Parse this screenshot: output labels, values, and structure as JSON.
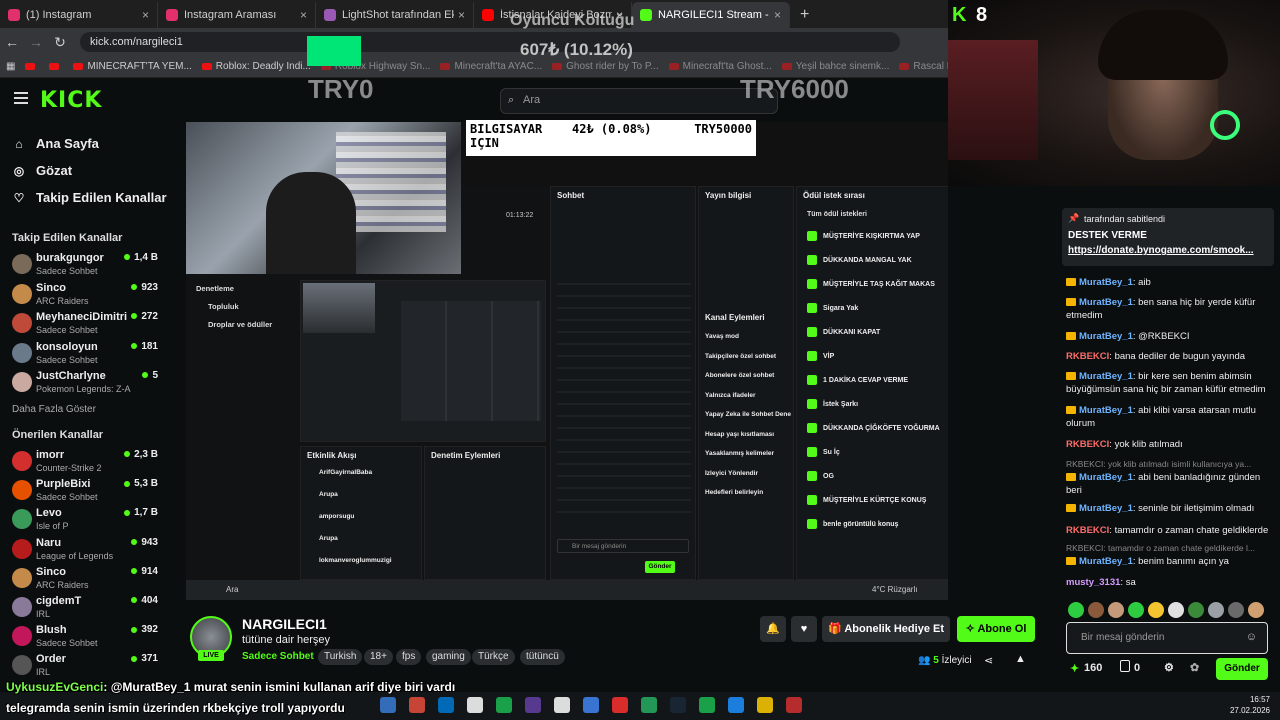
{
  "browser": {
    "tabs": [
      {
        "label": "(1) Instagram",
        "color": "#e1306c"
      },
      {
        "label": "Instagram Araması",
        "color": "#e1306c"
      },
      {
        "label": "LightShot tarafından Ekran Görü",
        "color": "#9b59b6"
      },
      {
        "label": "İstisnalar Kaideyi Bozmaz - You",
        "color": "#ff0000"
      },
      {
        "label": "NARGILECI1 Stream - Watc",
        "color": "#53fc18"
      }
    ],
    "new_tab": "+",
    "url": "kick.com/nargileci1",
    "bookmarks": [
      "",
      "",
      "MINECRAFT'TA YEM...",
      "Roblox: Deadly Indi...",
      "Roblox Highway Sn...",
      "Minecraft'ta AYAC...",
      "Ghost rider by To P...",
      "Minecraft'ta Ghost...",
      "Yeşil bahce sinemk...",
      "Rascal Does Not Dr..."
    ]
  },
  "header": {
    "logo": "KICK",
    "search_placeholder": "Ara"
  },
  "donation": {
    "title": "Oyuncu Koltuğu",
    "amount": "607₺ (10.12%)",
    "min": "TRY0",
    "max": "TRY6000",
    "pc_label": "BILGISAYAR",
    "pc_label2": "IÇIN",
    "pc_amount": "42₺ (0.08%)",
    "pc_goal": "TRY50000"
  },
  "sidebar": {
    "nav": [
      {
        "label": "Ana Sayfa",
        "icon": "home-icon"
      },
      {
        "label": "Gözat",
        "icon": "compass-icon"
      },
      {
        "label": "Takip Edilen Kanallar",
        "icon": "heart-icon"
      }
    ],
    "following_title": "Takip Edilen Kanallar",
    "following": [
      {
        "name": "burakgungor",
        "category": "Sadece Sohbet",
        "viewers": "1,4 B",
        "color": "#7a6a5a"
      },
      {
        "name": "Sinco",
        "category": "ARC Raiders",
        "viewers": "923",
        "color": "#c48a4a"
      },
      {
        "name": "MeyhaneciDimitri",
        "category": "Sadece Sohbet",
        "viewers": "272",
        "color": "#c04a3a"
      },
      {
        "name": "konsoloyun",
        "category": "Sadece Sohbet",
        "viewers": "181",
        "color": "#6a7a8a"
      },
      {
        "name": "JustCharlyne",
        "category": "Pokemon Legends: Z-A",
        "viewers": "5",
        "color": "#c9a9a0"
      }
    ],
    "more": "Daha Fazla Göster",
    "recommended_title": "Önerilen Kanallar",
    "recommended": [
      {
        "name": "imorr",
        "category": "Counter-Strike 2",
        "viewers": "2,3 B",
        "color": "#d32f2f"
      },
      {
        "name": "PurpleBixi",
        "category": "Sadece Sohbet",
        "viewers": "5,3 B",
        "color": "#e65100"
      },
      {
        "name": "Levo",
        "category": "Isle of P",
        "viewers": "1,7 B",
        "color": "#3a9a5a"
      },
      {
        "name": "Naru",
        "category": "League of Legends",
        "viewers": "943",
        "color": "#b71c1c"
      },
      {
        "name": "Sinco",
        "category": "ARC Raiders",
        "viewers": "914",
        "color": "#c48a4a"
      },
      {
        "name": "cigdemT",
        "category": "IRL",
        "viewers": "404",
        "color": "#8a7a9a"
      },
      {
        "name": "Blush",
        "category": "Sadece Sohbet",
        "viewers": "392",
        "color": "#c2185b"
      },
      {
        "name": "Order",
        "category": "IRL",
        "viewers": "371",
        "color": "#555"
      }
    ]
  },
  "inner_stream": {
    "panels": [
      "Sohbet",
      "Yayın bilgisi",
      "Ödül istek sırası",
      "Kanal Eylemleri",
      "Etkinlik Akışı",
      "Denetim Eylemleri"
    ],
    "side_menu": [
      "Denetleme",
      "Topluluk",
      "Droplar ve ödüller"
    ],
    "rewards_title": "Tüm ödül istekleri",
    "rewards": [
      "MÜŞTERİYE KIŞKIRTMA YAP",
      "DÜKKANDA MANGAL YAK",
      "MÜŞTERİYLE TAŞ KAĞIT MAKAS",
      "Sigara Yak",
      "DÜKKANI KAPAT",
      "VİP",
      "1 DAKİKA CEVAP VERME",
      "İstek Şarkı",
      "DÜKKANDA ÇİĞKÖFTE YOĞURMA",
      "Su İç",
      "OG",
      "MÜŞTERİYLE KÜRTÇE KONUŞ",
      "benle görüntülü konuş"
    ],
    "actions": [
      "Yavaş mod",
      "Takipçilere özel sohbet",
      "Abonelere özel sohbet",
      "Yalnızca ifadeler",
      "Yapay Zeka ile Sohbet Denetimi",
      "Hesap yaşı kısıtlaması",
      "Yasaklanmış kelimeler",
      "İzleyici Yönlendir",
      "Hedefleri belirleyin"
    ],
    "events": [
      "ArifGayirnalBaba",
      "Arupa",
      "amporsugu",
      "Arupa",
      "lokmanveroglummuzigi"
    ],
    "uptime": "01:13:22",
    "send": "Gönder",
    "input_ph": "Bir mesaj gönderin",
    "taskbar_search": "Ara",
    "weather": "4°C Rüzgarlı"
  },
  "webcam": {
    "kick_icon": "K",
    "viewer_count": "8"
  },
  "chat": {
    "pinned_by": "tarafından sabitlendi",
    "pinned_title": "DESTEK VERME",
    "pinned_url": "https://donate.bynogame.com/smook...",
    "messages": [
      {
        "user": "MuratBey_1",
        "text": "aib",
        "badge": true,
        "color": "#6fb4ff",
        "reply": ""
      },
      {
        "user": "MuratBey_1",
        "text": "ben sana hiç bir yerde küfür etmedim",
        "badge": true,
        "color": "#6fb4ff",
        "reply": ""
      },
      {
        "user": "MuratBey_1",
        "text": "@RKBEKCI",
        "badge": true,
        "color": "#6fb4ff",
        "reply": ""
      },
      {
        "user": "RKBEKCI",
        "text": "bana dediler de bugun yayında",
        "badge": false,
        "color": "#ff6b6b",
        "reply": ""
      },
      {
        "user": "MuratBey_1",
        "text": "bir kere sen benim abimsin büyüğümsün sana hiç bir zaman küfür etmedim",
        "badge": true,
        "color": "#6fb4ff",
        "reply": ""
      },
      {
        "user": "MuratBey_1",
        "text": "abi klibi varsa atarsan mutlu olurum",
        "badge": true,
        "color": "#6fb4ff",
        "reply": ""
      },
      {
        "user": "RKBEKCI",
        "text": "yok klib atılmadı",
        "badge": false,
        "color": "#ff6b6b",
        "reply": ""
      },
      {
        "user": "MuratBey_1",
        "text": "abi beni banladığınız günden beri",
        "badge": true,
        "color": "#6fb4ff",
        "reply": "RKBEKCI: yok klib atılmadı isimli kullanıcıya ya..."
      },
      {
        "user": "MuratBey_1",
        "text": "seninle bir iletişimim olmadı",
        "badge": true,
        "color": "#6fb4ff",
        "reply": ""
      },
      {
        "user": "RKBEKCI",
        "text": "tamamdır o zaman chate geldiklerde",
        "badge": false,
        "color": "#ff6b6b",
        "reply": ""
      },
      {
        "user": "MuratBey_1",
        "text": "benim banımı açın ya",
        "badge": true,
        "color": "#6fb4ff",
        "reply": "RKBEKCI: tamamdır o zaman chate geldikerde l..."
      },
      {
        "user": "musty_3131",
        "text": "sa",
        "badge": false,
        "color": "#d59bff",
        "reply": ""
      }
    ],
    "input_placeholder": "Bir mesaj gönderin",
    "kick_points": "160",
    "zero": "0",
    "send_label": "Gönder"
  },
  "stream": {
    "streamer": "NARGILECI1",
    "title": "tütüne dair herşey",
    "live": "LIVE",
    "category": "Sadece Sohbet",
    "tags": [
      "Turkish",
      "18+",
      "fps",
      "gaming",
      "Türkçe",
      "tütüncü"
    ],
    "gift_label": "Abonelik Hediye Et",
    "sub_label": "Abone Ol",
    "viewers_num": "5",
    "viewers_label": "İzleyici"
  },
  "overlay": {
    "user": "UykusuzEvGenci",
    "line1": ": @MuratBey_1 murat senin ismini kullanan arif diye biri vardı",
    "line2": "telegramda senin ismin üzerinden rkbekçiye troll yapıyordu"
  },
  "clock": {
    "time": "16:57",
    "date": "27.02.2026"
  }
}
